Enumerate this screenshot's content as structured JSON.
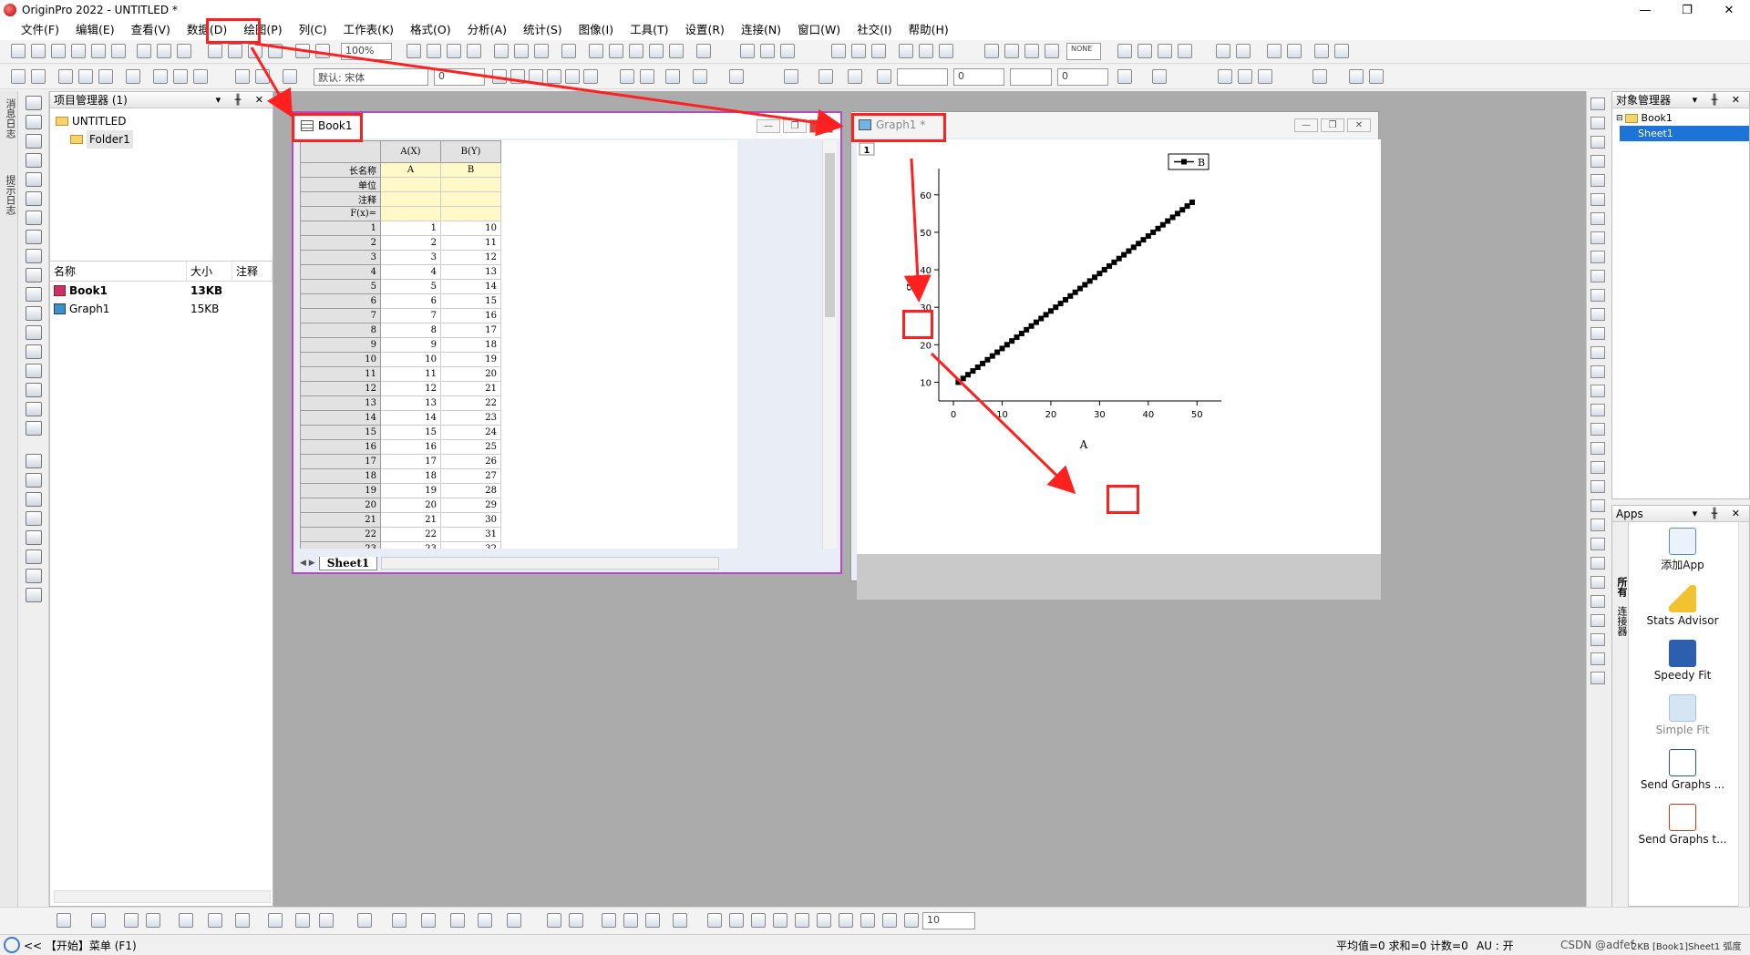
{
  "window": {
    "title": "OriginPro 2022 - UNTITLED *",
    "controls": [
      "—",
      "❐",
      "✕"
    ]
  },
  "menu": [
    "文件(F)",
    "编辑(E)",
    "查看(V)",
    "数据(D)",
    "绘图(P)",
    "列(C)",
    "工作表(K)",
    "格式(O)",
    "分析(A)",
    "统计(S)",
    "图像(I)",
    "工具(T)",
    "设置(R)",
    "连接(N)",
    "窗口(W)",
    "社交(I)",
    "帮助(H)"
  ],
  "toolbar": {
    "zoom": "100%",
    "font": "默认: 宋体",
    "font_size": "0",
    "line_width": "0",
    "line_width2": "0",
    "symbol_size": "0",
    "none_label": "NONE",
    "bottom_select": "10"
  },
  "left_strip": {
    "labels": [
      "消息日志",
      "提示日志"
    ]
  },
  "project_manager": {
    "title": "项目管理器 (1)",
    "root": "UNTITLED",
    "folder": "Folder1",
    "columns": [
      "名称",
      "大小",
      "注释"
    ],
    "items": [
      {
        "name": "Book1",
        "size": "13KB"
      },
      {
        "name": "Graph1",
        "size": "15KB"
      }
    ]
  },
  "book": {
    "title": "Book1",
    "col_a": "A(X)",
    "col_b": "B(Y)",
    "meta_labels": [
      "长名称",
      "单位",
      "注释",
      "F(x)="
    ],
    "long_name_a": "A",
    "long_name_b": "B",
    "rows": [
      [
        "1",
        "1",
        "10"
      ],
      [
        "2",
        "2",
        "11"
      ],
      [
        "3",
        "3",
        "12"
      ],
      [
        "4",
        "4",
        "13"
      ],
      [
        "5",
        "5",
        "14"
      ],
      [
        "6",
        "6",
        "15"
      ],
      [
        "7",
        "7",
        "16"
      ],
      [
        "8",
        "8",
        "17"
      ],
      [
        "9",
        "9",
        "18"
      ],
      [
        "10",
        "10",
        "19"
      ],
      [
        "11",
        "11",
        "20"
      ],
      [
        "12",
        "12",
        "21"
      ],
      [
        "13",
        "13",
        "22"
      ],
      [
        "14",
        "14",
        "23"
      ],
      [
        "15",
        "15",
        "24"
      ],
      [
        "16",
        "16",
        "25"
      ],
      [
        "17",
        "17",
        "26"
      ],
      [
        "18",
        "18",
        "27"
      ],
      [
        "19",
        "19",
        "28"
      ],
      [
        "20",
        "20",
        "29"
      ],
      [
        "21",
        "21",
        "30"
      ],
      [
        "22",
        "22",
        "31"
      ],
      [
        "23",
        "23",
        "32"
      ]
    ],
    "sheet_tab": "Sheet1"
  },
  "graph": {
    "title": "Graph1 *",
    "layer": "1",
    "x_title": "A",
    "y_title": "B",
    "legend": "B",
    "x_ticks": [
      "0",
      "10",
      "20",
      "30",
      "40",
      "50"
    ],
    "y_ticks": [
      "10",
      "20",
      "30",
      "40",
      "50",
      "60"
    ]
  },
  "chart_data": {
    "type": "line",
    "xlabel": "A",
    "ylabel": "B",
    "xlim": [
      -3,
      55
    ],
    "ylim": [
      5,
      67
    ],
    "series": [
      {
        "name": "B",
        "x": [
          1,
          2,
          3,
          4,
          5,
          6,
          7,
          8,
          9,
          10,
          11,
          12,
          13,
          14,
          15,
          16,
          17,
          18,
          19,
          20,
          21,
          22,
          23,
          24,
          25,
          26,
          27,
          28,
          29,
          30,
          31,
          32,
          33,
          34,
          35,
          36,
          37,
          38,
          39,
          40,
          41,
          42,
          43,
          44,
          45,
          46,
          47,
          48,
          49
        ],
        "y": [
          10,
          11,
          12,
          13,
          14,
          15,
          16,
          17,
          18,
          19,
          20,
          21,
          22,
          23,
          24,
          25,
          26,
          27,
          28,
          29,
          30,
          31,
          32,
          33,
          34,
          35,
          36,
          37,
          38,
          39,
          40,
          41,
          42,
          43,
          44,
          45,
          46,
          47,
          48,
          49,
          50,
          51,
          52,
          53,
          54,
          55,
          56,
          57,
          58
        ]
      }
    ],
    "legend_position": "top-right",
    "grid": false
  },
  "object_manager": {
    "title": "对象管理器",
    "items": [
      "Book1",
      "Sheet1"
    ]
  },
  "apps": {
    "title": "Apps",
    "tabs": [
      "所有",
      "连接器"
    ],
    "items": [
      {
        "label": "添加App",
        "icon": "add-app-icon"
      },
      {
        "label": "Stats Advisor",
        "icon": "wand-icon"
      },
      {
        "label": "Speedy Fit",
        "icon": "speedy-fit-icon"
      },
      {
        "label": "Simple Fit",
        "icon": "simple-fit-icon"
      },
      {
        "label": "Send Graphs ...",
        "icon": "word-icon"
      },
      {
        "label": "Send Graphs t...",
        "icon": "ppt-icon"
      }
    ]
  },
  "status": {
    "start_menu": "<< 【开始】菜单 (F1)",
    "stats": "平均值=0 求和=0 计数=0",
    "au": "AU : 开",
    "right_info": "CSDN @adfef",
    "extra": "2KB [Book1]Sheet1 弧度"
  },
  "colors": {
    "highlight": "#ff2020",
    "sheet_meta": "#fff9c7",
    "workspace": "#ababab",
    "selected": "#1e73d6"
  }
}
